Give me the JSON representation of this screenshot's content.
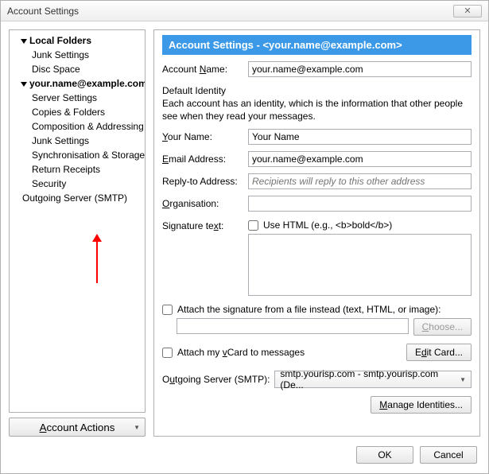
{
  "window": {
    "title": "Account Settings",
    "close_symbol": "✕"
  },
  "tree": {
    "local_folders": "Local Folders",
    "junk1": "Junk Settings",
    "disc_space": "Disc Space",
    "account": "your.name@example.com",
    "server_settings": "Server Settings",
    "copies_folders": "Copies & Folders",
    "composition": "Composition & Addressing",
    "junk2": "Junk Settings",
    "sync_storage": "Synchronisation & Storage",
    "return_receipts": "Return Receipts",
    "security": "Security",
    "outgoing_smtp": "Outgoing Server (SMTP)"
  },
  "account_actions": "Account Actions",
  "panel": {
    "title": "Account Settings - <your.name@example.com>",
    "account_name_label": "Account Name:",
    "account_name_value": "your.name@example.com",
    "default_identity": "Default Identity",
    "identity_desc": "Each account has an identity, which is the information that other people see when they read your messages.",
    "your_name_label": "Your Name:",
    "your_name_value": "Your Name",
    "email_label": "Email Address:",
    "email_value": "your.name@example.com",
    "replyto_label": "Reply-to Address:",
    "replyto_placeholder": "Recipients will reply to this other address",
    "org_label": "Organisation:",
    "sig_label": "Signature text:",
    "use_html": "Use HTML (e.g., <b>bold</b>)",
    "attach_file": "Attach the signature from a file instead (text, HTML, or image):",
    "choose": "Choose...",
    "vcard": "Attach my vCard to messages",
    "edit_card": "Edit Card...",
    "smtp_label": "Outgoing Server (SMTP):",
    "smtp_value": "smtp.yourisp.com - smtp.yourisp.com (De...",
    "manage_identities": "Manage Identities..."
  },
  "footer": {
    "ok": "OK",
    "cancel": "Cancel"
  }
}
